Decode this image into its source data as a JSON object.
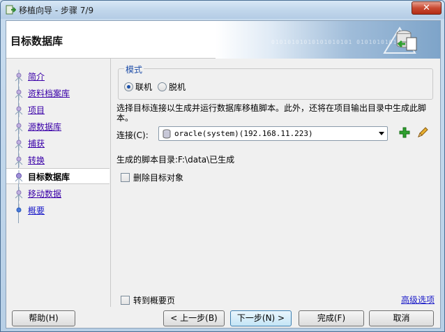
{
  "window": {
    "title": "移植向导 - 步骤 7/9",
    "close_label": "✕"
  },
  "header": {
    "title": "目标数据库",
    "binary_text": "01010101010101010101 01010101010"
  },
  "nav": {
    "items": [
      {
        "label": "简介"
      },
      {
        "label": "资料档案库"
      },
      {
        "label": "项目"
      },
      {
        "label": "源数据库"
      },
      {
        "label": "捕获"
      },
      {
        "label": "转换"
      },
      {
        "label": "目标数据库"
      },
      {
        "label": "移动数据"
      },
      {
        "label": "概要"
      }
    ]
  },
  "mode": {
    "title": "模式",
    "online_label": "联机",
    "offline_label": "脱机",
    "selected": "联机"
  },
  "description": "选择目标连接以生成并运行数据库移植脚本。此外，还将在项目输出目录中生成此脚本。",
  "connection": {
    "label": "连接(C):",
    "value": "oracle(system)(192.168.11.223)"
  },
  "script_dir": "生成的脚本目录:F:\\data\\已生成",
  "drop_target_label": "删除目标对象",
  "goto_summary_label": "转到概要页",
  "advanced_link": "高级选项",
  "buttons": {
    "help": "帮助(H)",
    "back": "< 上一步(B)",
    "next": "下一步(N) >",
    "finish": "完成(F)",
    "cancel": "取消"
  },
  "colors": {
    "link": "#3a00a8",
    "group_title": "#1f4ea8",
    "close": "#c94a32"
  }
}
